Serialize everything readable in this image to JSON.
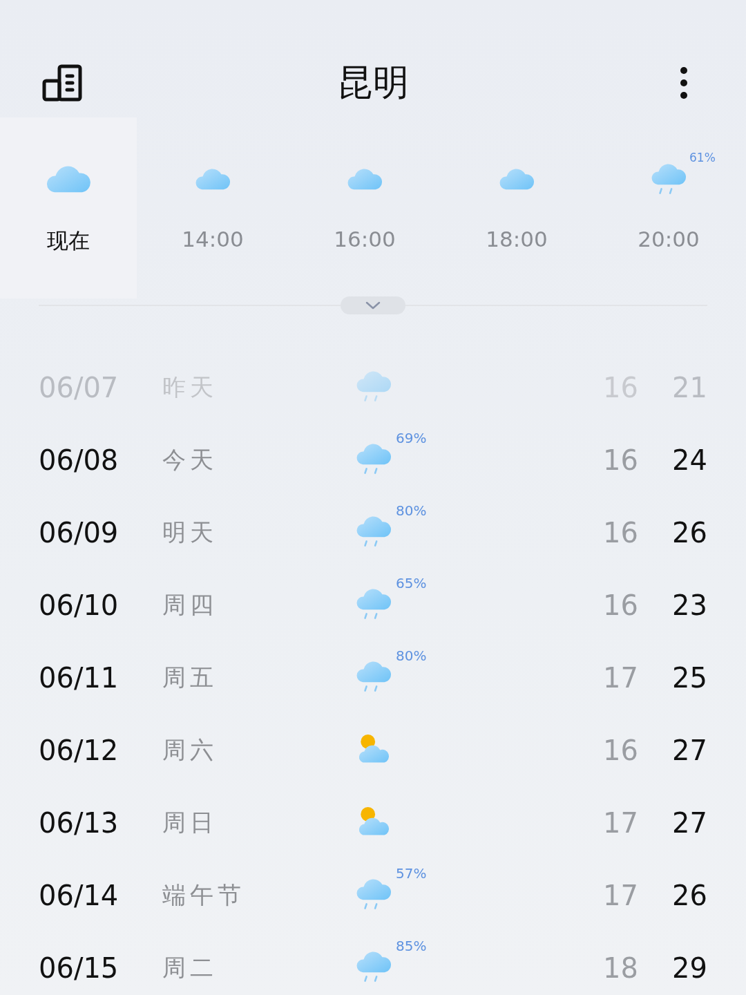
{
  "header": {
    "title": "昆明"
  },
  "hourly": [
    {
      "time": "现在",
      "kind": "cloudy",
      "selected": true
    },
    {
      "time": "14:00",
      "kind": "cloudy",
      "selected": false
    },
    {
      "time": "16:00",
      "kind": "cloudy",
      "selected": false
    },
    {
      "time": "18:00",
      "kind": "cloudy",
      "selected": false
    },
    {
      "time": "20:00",
      "kind": "rain",
      "chance": "61%",
      "selected": false
    }
  ],
  "daily": [
    {
      "date": "06/07",
      "day": "昨天",
      "kind": "rain",
      "low": "16",
      "high": "21",
      "past": true
    },
    {
      "date": "06/08",
      "day": "今天",
      "kind": "rain",
      "chance": "69%",
      "low": "16",
      "high": "24",
      "past": false
    },
    {
      "date": "06/09",
      "day": "明天",
      "kind": "rain",
      "chance": "80%",
      "low": "16",
      "high": "26",
      "past": false
    },
    {
      "date": "06/10",
      "day": "周四",
      "kind": "rain",
      "chance": "65%",
      "low": "16",
      "high": "23",
      "past": false
    },
    {
      "date": "06/11",
      "day": "周五",
      "kind": "rain",
      "chance": "80%",
      "low": "17",
      "high": "25",
      "past": false
    },
    {
      "date": "06/12",
      "day": "周六",
      "kind": "partly",
      "low": "16",
      "high": "27",
      "past": false
    },
    {
      "date": "06/13",
      "day": "周日",
      "kind": "partly",
      "low": "17",
      "high": "27",
      "past": false
    },
    {
      "date": "06/14",
      "day": "端午节",
      "kind": "rain",
      "chance": "57%",
      "low": "17",
      "high": "26",
      "past": false
    },
    {
      "date": "06/15",
      "day": "周二",
      "kind": "rain",
      "chance": "85%",
      "low": "18",
      "high": "29",
      "past": false
    }
  ]
}
